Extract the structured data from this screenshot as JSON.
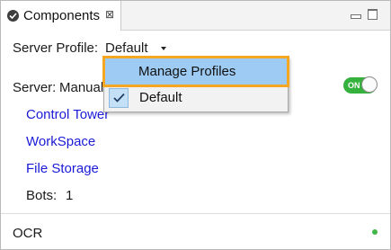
{
  "tab": {
    "title": "Components",
    "icon": "components-check-icon",
    "close_glyph": "⊠"
  },
  "window_controls": {
    "minimize_icon": "minimize-icon",
    "maximize_icon": "maximize-icon"
  },
  "server_profile": {
    "label": "Server Profile:",
    "value": "Default"
  },
  "server": {
    "label": "Server:",
    "mode": "Manual",
    "toggle_label": "ON",
    "toggle_state": "on",
    "toggle_color": "#35b13e"
  },
  "links": [
    "Control Tower",
    "WorkSpace",
    "File Storage"
  ],
  "bots": {
    "label": "Bots:",
    "value": "1"
  },
  "ocr": {
    "label": "OCR",
    "status_color": "#41b649"
  },
  "profile_menu": {
    "items": [
      {
        "label": "Manage Profiles",
        "highlighted": true
      },
      {
        "label": "Default",
        "checked": true
      }
    ],
    "highlight_color": "#f5a623"
  }
}
